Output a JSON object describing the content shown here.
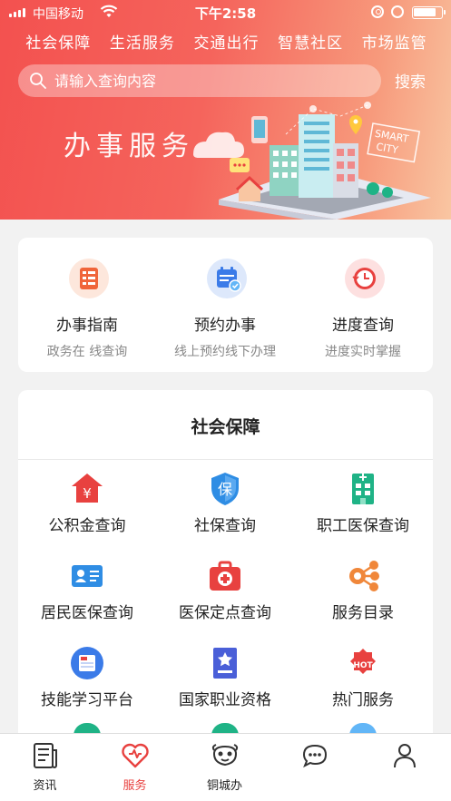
{
  "status_bar": {
    "carrier": "中国移动",
    "time": "下午2:58"
  },
  "top_nav": [
    "社会保障",
    "生活服务",
    "交通出行",
    "智慧社区",
    "市场监管"
  ],
  "search": {
    "placeholder": "请输入查询内容",
    "button_label": "搜索"
  },
  "banner": {
    "title": "办事服务",
    "smart_text": "SMART",
    "city_text": "CITY"
  },
  "quick_services": [
    {
      "title": "办事指南",
      "subtitle": "政务在 线查询",
      "icon": "checklist-icon",
      "color": "#f0653a"
    },
    {
      "title": "预约办事",
      "subtitle": "线上预约线下办理",
      "icon": "calendar-icon",
      "color": "#3b7be8"
    },
    {
      "title": "进度查询",
      "subtitle": "进度实时掌握",
      "icon": "clock-icon",
      "color": "#e8413f"
    }
  ],
  "social_security": {
    "title": "社会保障",
    "items": [
      {
        "label": "公积金查询",
        "icon": "house-fund-icon",
        "color": "#e8413f"
      },
      {
        "label": "社保查询",
        "icon": "shield-icon",
        "color": "#2f8de4"
      },
      {
        "label": "职工医保查询",
        "icon": "hospital-building-icon",
        "color": "#1fb386"
      },
      {
        "label": "居民医保查询",
        "icon": "id-card-icon",
        "color": "#2f8de4"
      },
      {
        "label": "医保定点查询",
        "icon": "medical-kit-icon",
        "color": "#e8413f"
      },
      {
        "label": "服务目录",
        "icon": "network-icon",
        "color": "#f0873a"
      },
      {
        "label": "技能学习平台",
        "icon": "document-icon",
        "color": "#3b7be8"
      },
      {
        "label": "国家职业资格",
        "icon": "certificate-icon",
        "color": "#4a5fd8"
      },
      {
        "label": "热门服务",
        "icon": "hot-badge-icon",
        "color": "#e8413f"
      }
    ],
    "hot_badge_text": "HOT",
    "fund_symbol": "¥",
    "shield_text": "保"
  },
  "tab_bar": [
    {
      "label": "资讯",
      "icon": "news-icon",
      "active": false
    },
    {
      "label": "服务",
      "icon": "heart-icon",
      "active": true
    },
    {
      "label": "铜城办",
      "icon": "mascot-icon",
      "active": false
    },
    {
      "label": "",
      "icon": "chat-icon",
      "active": false
    },
    {
      "label": "",
      "icon": "user-icon",
      "active": false
    }
  ],
  "colors": {
    "primary": "#e8413f",
    "header_start": "#f3514f",
    "header_end": "#f9c6a2"
  }
}
